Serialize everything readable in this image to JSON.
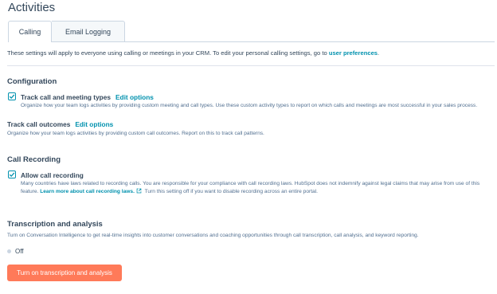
{
  "page": {
    "title": "Activities"
  },
  "tabs": [
    {
      "label": "Calling"
    },
    {
      "label": "Email Logging"
    }
  ],
  "intro": {
    "text": "These settings will apply to everyone using calling or meetings in your CRM. To edit your personal calling settings, go to ",
    "link": "user preferences",
    "suffix": "."
  },
  "configuration": {
    "title": "Configuration",
    "track_types": {
      "label": "Track call and meeting types",
      "edit": "Edit options",
      "checked": true,
      "desc": "Organize how your team logs activities by providing custom meeting and call types. Use these custom activity types to report on which calls and meetings are most successful in your sales process."
    },
    "track_outcomes": {
      "label": "Track call outcomes",
      "edit": "Edit options",
      "desc": "Organize how your team logs activities by providing custom call outcomes. Report on this to track call patterns."
    }
  },
  "call_recording": {
    "title": "Call Recording",
    "allow": {
      "label": "Allow call recording",
      "checked": true,
      "desc_part1": "Many countries have laws related to recording calls. You are responsible for your compliance with call recording laws. HubSpot does not indemnify against legal claims that may arise from use of this feature. ",
      "link": "Learn more about call recording laws.",
      "desc_part2": " Turn this setting off if you want to disable recording across an entire portal."
    }
  },
  "transcription": {
    "title": "Transcription and analysis",
    "desc": "Turn on Conversation Intelligence to get real-time insights into customer conversations and coaching opportunities through call transcription, call analysis, and keyword reporting.",
    "status": "Off",
    "button": "Turn on transcription and analysis"
  },
  "colors": {
    "accent": "#0091ae",
    "button": "#ff7a59",
    "text": "#33475b"
  },
  "icons": {
    "checkbox": "check-icon",
    "external": "external-link-icon",
    "toggle": "toggle-dot-icon"
  }
}
